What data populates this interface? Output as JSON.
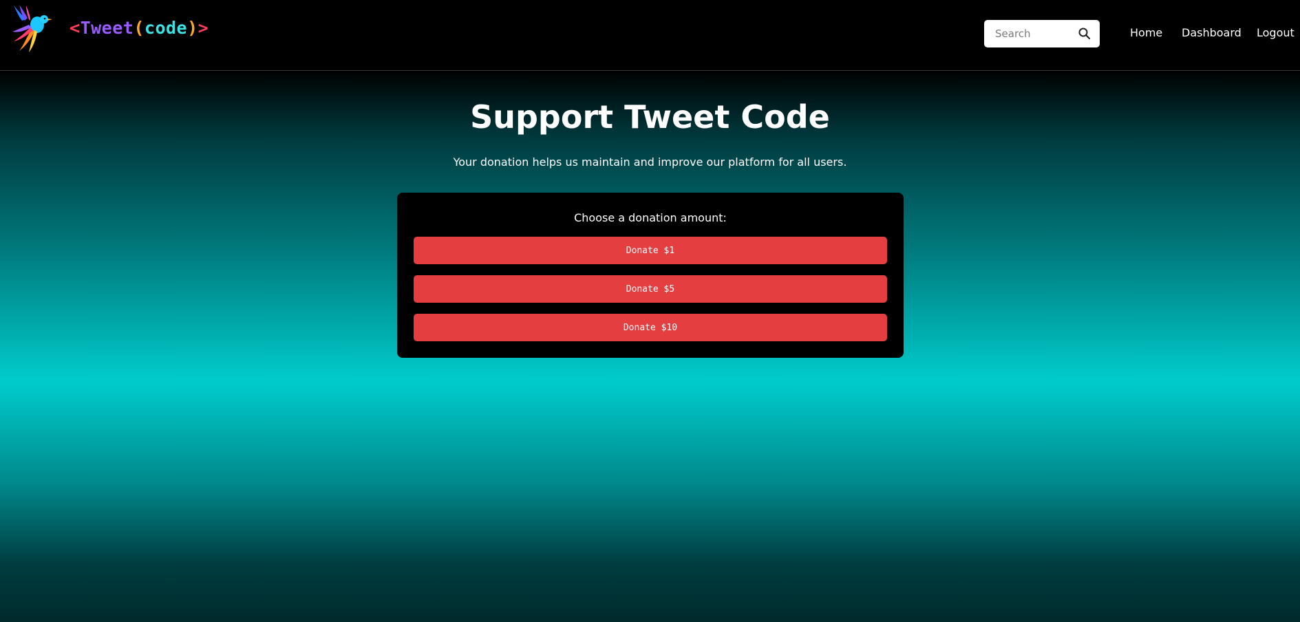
{
  "header": {
    "brand": {
      "open_angle": "<",
      "word": "Tweet",
      "open_paren": "(",
      "code": "code",
      "close_paren": ")",
      "close_angle": ">"
    },
    "search": {
      "placeholder": "Search",
      "value": ""
    },
    "nav": {
      "home": "Home",
      "dashboard": "Dashboard",
      "logout": "Logout"
    }
  },
  "main": {
    "title": "Support Tweet Code",
    "subtitle": "Your donation helps us maintain and improve our platform for all users.",
    "card": {
      "label": "Choose a donation amount:",
      "buttons": [
        "Donate $1",
        "Donate $5",
        "Donate $10"
      ]
    }
  },
  "icons": {
    "logo": "bird-logo-icon",
    "search": "search-icon"
  },
  "colors": {
    "header_bg": "#000000",
    "card_bg": "#000000",
    "button_bg": "#e53e40",
    "gradient_mid": "#00cccc",
    "brand_angle": "#ff3d5a",
    "brand_word": "#9b5cff",
    "brand_paren": "#ffa82a",
    "brand_code": "#39e3e3"
  }
}
